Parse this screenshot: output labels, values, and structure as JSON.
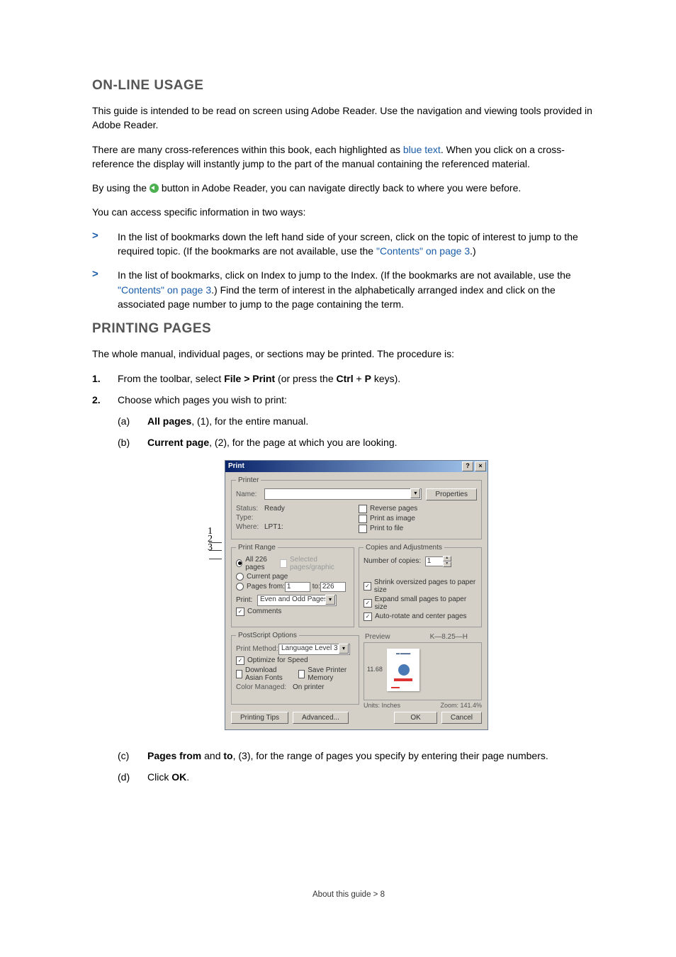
{
  "sections": {
    "online_usage_title": "ON-LINE USAGE",
    "printing_pages_title": "PRINTING PAGES"
  },
  "para": {
    "p1": "This guide is intended to be read on screen using Adobe Reader. Use the navigation and viewing tools provided in Adobe Reader.",
    "p2a": "There are many cross-references within this book, each highlighted as ",
    "p2_link": "blue text",
    "p2b": ". When you click on a cross-reference the display will instantly jump to the part of the manual containing the referenced material.",
    "p3a": "By using the ",
    "p3b": " button in Adobe Reader, you can navigate directly back to where you were before.",
    "p4": "You can access specific information in two ways:",
    "bullet1a": "In the list of bookmarks down the left hand side of your screen, click on the topic of interest to jump to the required topic. (If the bookmarks are not available, use the ",
    "bullet1_link": "\"Contents\" on page 3",
    "bullet1b": ".)",
    "bullet2a": "In the list of bookmarks, click on Index to jump to the Index. (If the bookmarks are not available, use the ",
    "bullet2_link": "\"Contents\" on page 3",
    "bullet2b": ".) Find the term of interest in the alphabetically arranged index and click on the associated page number to jump to the page containing the term.",
    "pp1": "The whole manual, individual pages, or sections may be printed. The procedure is:",
    "step1a": "From the toolbar, select ",
    "step1_filep": "File > Print",
    "step1b": " (or press the ",
    "step1_ctrl": "Ctrl",
    "step1_plus": " + ",
    "step1_p": "P",
    "step1c": " keys).",
    "step2": "Choose which pages you wish to print:",
    "sub_a_bold": "All pages",
    "sub_a_rest": ", (1), for the entire manual.",
    "sub_b_bold": "Current page",
    "sub_b_rest": ", (2), for the page at which you are looking.",
    "sub_c_bold1": "Pages from",
    "sub_c_mid": " and ",
    "sub_c_bold2": "to",
    "sub_c_rest": ", (3), for the range of pages you specify by entering their page numbers.",
    "sub_d_a": "Click ",
    "sub_d_bold": "OK",
    "sub_d_b": "."
  },
  "markers": {
    "chevron": ">",
    "n1": "1.",
    "n2": "2.",
    "sa": "(a)",
    "sb": "(b)",
    "sc": "(c)",
    "sd": "(d)"
  },
  "dlg_labels": {
    "l1": "1",
    "l2": "2",
    "l3": "3"
  },
  "dialog": {
    "title": "Print",
    "help_btn": "?",
    "close_btn": "×",
    "printer_legend": "Printer",
    "name_label": "Name:",
    "properties_btn": "Properties",
    "status_label": "Status:",
    "status_value": "Ready",
    "type_label": "Type:",
    "where_label": "Where:",
    "where_value": "LPT1:",
    "reverse_pages": "Reverse pages",
    "print_as_image": "Print as image",
    "print_to_file": "Print to file",
    "range_legend": "Print Range",
    "all_pages": "All 226 pages",
    "selected_pages": "Selected pages/graphic",
    "current_page": "Current page",
    "pages_from": "Pages from:",
    "pages_from_val": "1",
    "pages_to": "to:",
    "pages_to_val": "226",
    "print_label": "Print:",
    "print_dd": "Even and Odd Pages",
    "comments_cb": "Comments",
    "copies_legend": "Copies and Adjustments",
    "num_copies": "Number of copies:",
    "num_copies_val": "1",
    "shrink": "Shrink oversized pages to paper size",
    "expand": "Expand small pages to paper size",
    "autorotate": "Auto-rotate and center pages",
    "ps_legend": "PostScript Options",
    "print_method": "Print Method:",
    "print_method_val": "Language Level 3",
    "opt_speed": "Optimize for Speed",
    "dl_asian": "Download Asian Fonts",
    "save_mem": "Save Printer Memory",
    "color_managed": "Color Managed:",
    "on_printer": "On printer",
    "preview_legend": "Preview",
    "preview_w": "8.25",
    "preview_h": "11.68",
    "units": "Units: Inches",
    "zoom": "Zoom: 141.4%",
    "tips_btn": "Printing Tips",
    "advanced_btn": "Advanced...",
    "ok_btn": "OK",
    "cancel_btn": "Cancel"
  },
  "footer": "About this guide > 8"
}
